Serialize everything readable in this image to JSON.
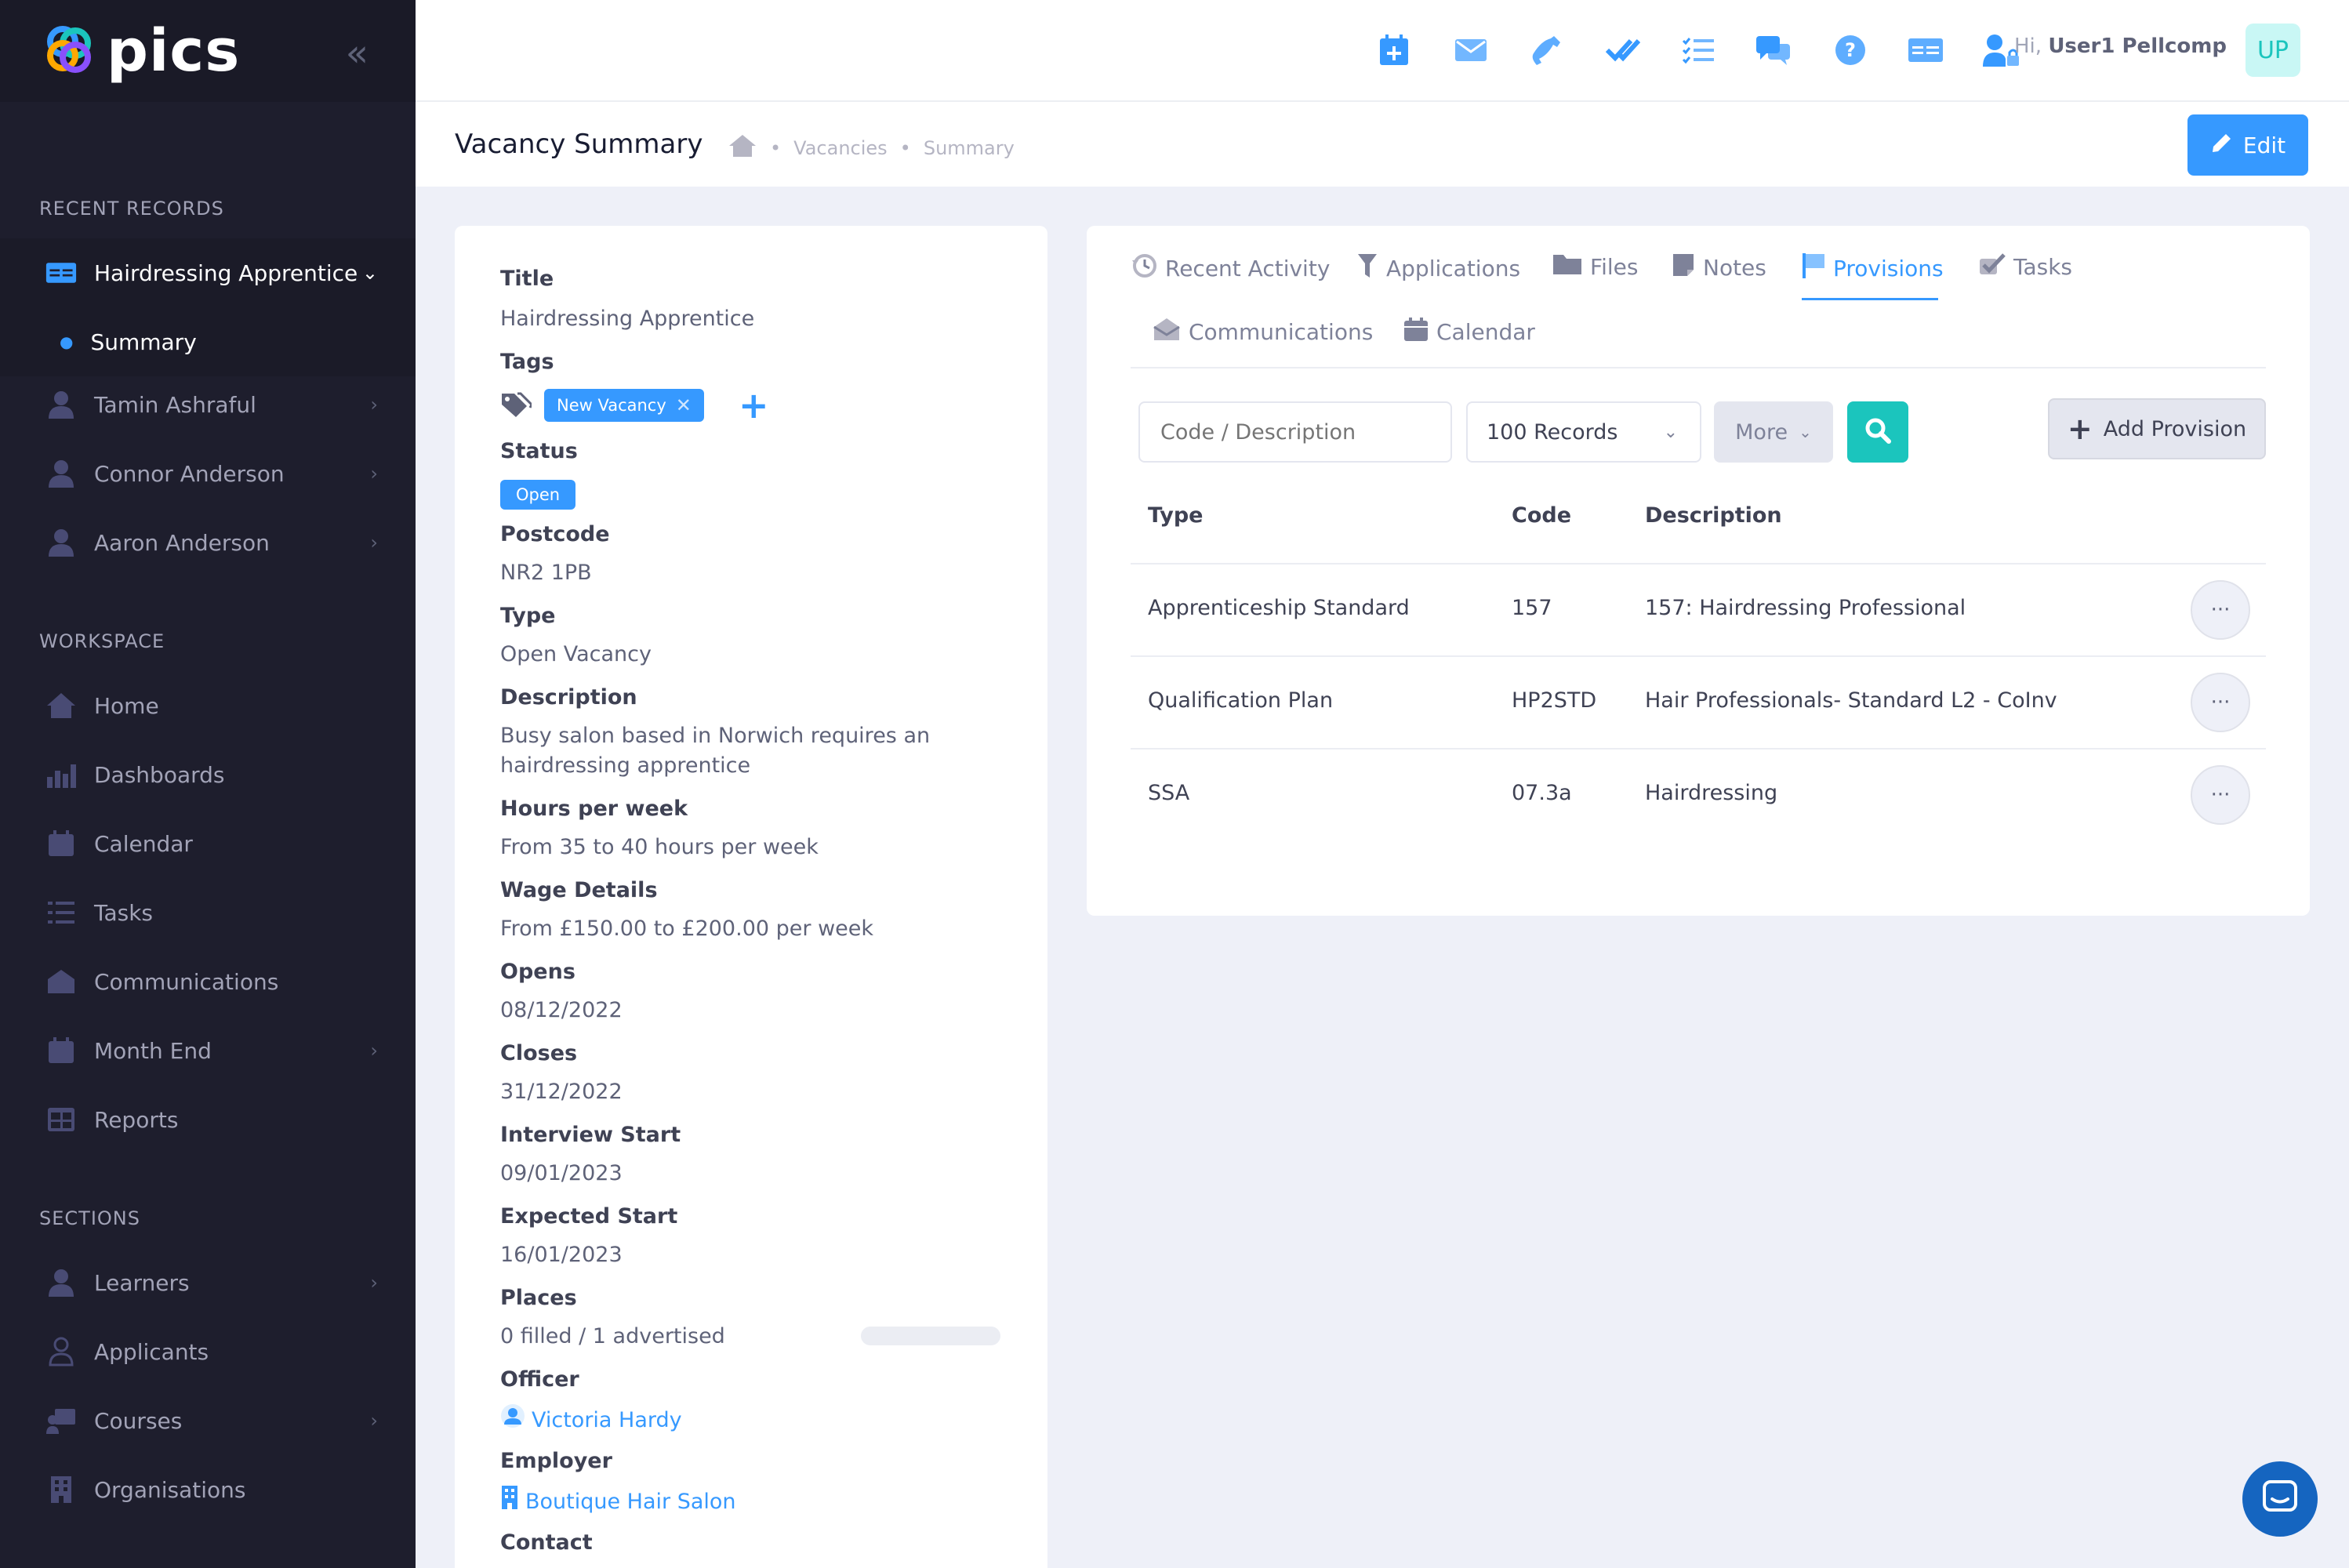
{
  "brand": {
    "name": "pics"
  },
  "sidebar": {
    "recent_records_heading": "RECENT RECORDS",
    "recent": [
      {
        "label": "Hairdressing Apprentice",
        "icon": "id-card-icon"
      },
      {
        "label": "Summary"
      },
      {
        "label": "Tamin Ashraful",
        "icon": "user-icon"
      },
      {
        "label": "Connor Anderson",
        "icon": "user-icon"
      },
      {
        "label": "Aaron Anderson",
        "icon": "user-icon"
      }
    ],
    "workspace_heading": "WORKSPACE",
    "workspace": [
      {
        "label": "Home",
        "icon": "home-icon"
      },
      {
        "label": "Dashboards",
        "icon": "chart-icon"
      },
      {
        "label": "Calendar",
        "icon": "calendar-icon"
      },
      {
        "label": "Tasks",
        "icon": "list-icon"
      },
      {
        "label": "Communications",
        "icon": "envelope-icon"
      },
      {
        "label": "Month End",
        "icon": "calendar-icon"
      },
      {
        "label": "Reports",
        "icon": "table-icon"
      }
    ],
    "sections_heading": "SECTIONS",
    "sections": [
      {
        "label": "Learners",
        "icon": "user-icon"
      },
      {
        "label": "Applicants",
        "icon": "user-outline-icon"
      },
      {
        "label": "Courses",
        "icon": "board-icon"
      },
      {
        "label": "Organisations",
        "icon": "building-icon"
      }
    ]
  },
  "topbar": {
    "greeting_prefix": "Hi,",
    "user_name": "User1 Pellcomp",
    "avatar_initials": "UP",
    "icons": [
      "calendar-plus-icon",
      "envelope-icon",
      "phone-icon",
      "double-check-icon",
      "checklist-icon",
      "chat-icon",
      "help-icon",
      "id-card-icon",
      "user-lock-icon"
    ]
  },
  "subheader": {
    "title": "Vacancy Summary",
    "breadcrumbs": [
      "Vacancies",
      "Summary"
    ],
    "edit_label": "Edit"
  },
  "details": {
    "title_label": "Title",
    "title_value": "Hairdressing Apprentice",
    "tags_label": "Tags",
    "tag": "New Vacancy",
    "status_label": "Status",
    "status_value": "Open",
    "postcode_label": "Postcode",
    "postcode_value": "NR2 1PB",
    "type_label": "Type",
    "type_value": "Open Vacancy",
    "description_label": "Description",
    "description_value": "Busy salon based in Norwich requires an hairdressing apprentice",
    "hours_label": "Hours per week",
    "hours_value": "From 35 to 40 hours per week",
    "wage_label": "Wage Details",
    "wage_value": "From £150.00 to £200.00 per week",
    "opens_label": "Opens",
    "opens_value": "08/12/2022",
    "closes_label": "Closes",
    "closes_value": "31/12/2022",
    "interview_label": "Interview Start",
    "interview_value": "09/01/2023",
    "expected_label": "Expected Start",
    "expected_value": "16/01/2023",
    "places_label": "Places",
    "places_value": "0 filled / 1 advertised",
    "officer_label": "Officer",
    "officer_value": "Victoria Hardy",
    "employer_label": "Employer",
    "employer_value": "Boutique Hair Salon",
    "contact_label": "Contact"
  },
  "tabs": [
    {
      "label": "Recent Activity",
      "icon": "history-icon"
    },
    {
      "label": "Applications",
      "icon": "funnel-icon"
    },
    {
      "label": "Files",
      "icon": "folder-icon"
    },
    {
      "label": "Notes",
      "icon": "note-icon"
    },
    {
      "label": "Provisions",
      "icon": "flag-icon",
      "active": true
    },
    {
      "label": "Tasks",
      "icon": "check-icon"
    },
    {
      "label": "Communications",
      "icon": "envelope-open-icon"
    },
    {
      "label": "Calendar",
      "icon": "calendar-icon"
    }
  ],
  "filters": {
    "search_placeholder": "Code / Description",
    "records_value": "100 Records",
    "more_label": "More",
    "add_label": "Add Provision"
  },
  "table": {
    "headers": [
      "Type",
      "Code",
      "Description"
    ],
    "rows": [
      {
        "type": "Apprenticeship Standard",
        "code": "157",
        "description": "157: Hairdressing Professional"
      },
      {
        "type": "Qualification Plan",
        "code": "HP2STD",
        "description": "Hair Professionals- Standard L2 - CoInv"
      },
      {
        "type": "SSA",
        "code": "07.3a",
        "description": "Hairdressing"
      }
    ]
  },
  "colors": {
    "primary": "#3699ff",
    "success": "#1bc5bd",
    "sidebar": "#1e1e2d"
  }
}
